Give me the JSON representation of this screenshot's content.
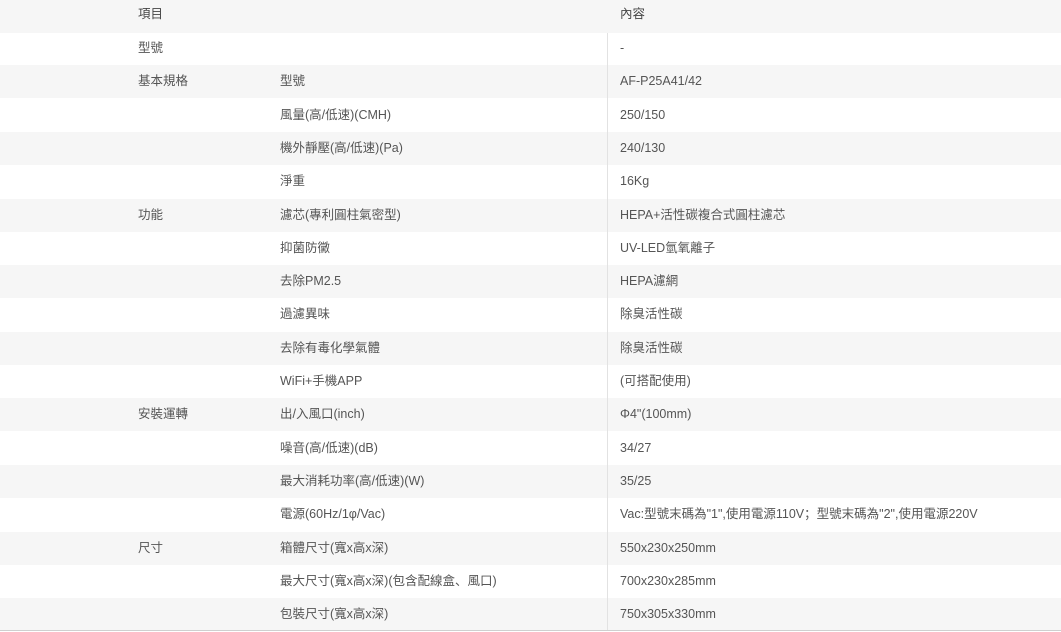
{
  "header": {
    "item": "項目",
    "content": "內容"
  },
  "rows": [
    {
      "category": "型號",
      "item": "",
      "value": "-"
    },
    {
      "category": "基本規格",
      "item": "型號",
      "value": "AF-P25A41/42"
    },
    {
      "category": "",
      "item": "風量(高/低速)(CMH)",
      "value": "250/150"
    },
    {
      "category": "",
      "item": "機外靜壓(高/低速)(Pa)",
      "value": "240/130"
    },
    {
      "category": "",
      "item": "淨重",
      "value": "16Kg"
    },
    {
      "category": "功能",
      "item": "濾芯(專利圓柱氣密型)",
      "value": "HEPA+活性碳複合式圓柱濾芯"
    },
    {
      "category": "",
      "item": "抑菌防黴",
      "value": "UV-LED氫氧離子"
    },
    {
      "category": "",
      "item": "去除PM2.5",
      "value": "HEPA濾網"
    },
    {
      "category": "",
      "item": "過濾異味",
      "value": "除臭活性碳"
    },
    {
      "category": "",
      "item": "去除有毒化學氣體",
      "value": "除臭活性碳"
    },
    {
      "category": "",
      "item": "WiFi+手機APP",
      "value": "(可搭配使用)"
    },
    {
      "category": "安裝運轉",
      "item": "出/入風口(inch)",
      "value": "Φ4\"(100mm)"
    },
    {
      "category": "",
      "item": "噪音(高/低速)(dB)",
      "value": "34/27"
    },
    {
      "category": "",
      "item": "最大消耗功率(高/低速)(W)",
      "value": "35/25"
    },
    {
      "category": "",
      "item": "電源(60Hz/1φ/Vac)",
      "value": "Vac:型號末碼為\"1\",使用電源110V；型號末碼為\"2\",使用電源220V"
    },
    {
      "category": "尺寸",
      "item": "箱體尺寸(寬x高x深)",
      "value": "550x230x250mm"
    },
    {
      "category": "",
      "item": "最大尺寸(寬x高x深)(包含配線盒、風口)",
      "value": "700x230x285mm"
    },
    {
      "category": "",
      "item": "包裝尺寸(寬x高x深)",
      "value": "750x305x330mm"
    }
  ]
}
